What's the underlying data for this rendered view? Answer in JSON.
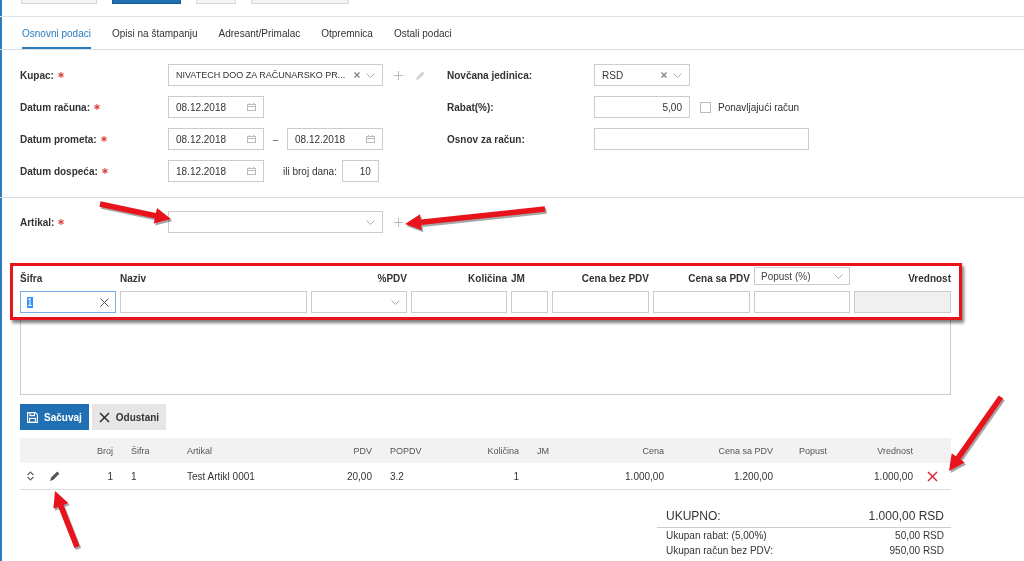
{
  "toolbar": {
    "buttons": [
      {
        "kind": "default"
      },
      {
        "kind": "primary"
      },
      {
        "kind": "default"
      },
      {
        "kind": "default"
      }
    ]
  },
  "tabs": [
    {
      "label": "Osnovni podaci",
      "selected": true
    },
    {
      "label": "Opisi na štampanju",
      "selected": false
    },
    {
      "label": "Adresant/Primalac",
      "selected": false
    },
    {
      "label": "Otpremnica",
      "selected": false
    },
    {
      "label": "Ostali podaci",
      "selected": false
    }
  ],
  "left_fields": [
    {
      "kind": "combo",
      "label": "Kupac:",
      "required": true,
      "value": "NIVATECH DOO ZA RAČUNARSKO PR...",
      "can_add": true,
      "can_edit": true
    },
    {
      "kind": "date",
      "label": "Datum računa:",
      "required": true,
      "value": "08.12.2018"
    },
    {
      "kind": "date_range",
      "label": "Datum prometa:",
      "required": true,
      "from": "08.12.2018",
      "separator": "–",
      "to": "08.12.2018"
    },
    {
      "kind": "date_days",
      "label": "Datum dospeća:",
      "required": true,
      "value": "18.12.2018",
      "days_label": "ili broj dana:",
      "days": "10"
    }
  ],
  "right_fields": [
    {
      "kind": "combo",
      "label": "Novčana jedinica:",
      "required": false,
      "value": "RSD"
    },
    {
      "kind": "number_check",
      "label": "Rabat(%):",
      "required": false,
      "value": "5,00",
      "checkbox": {
        "label": "Ponavljajući račun",
        "checked": false
      }
    },
    {
      "kind": "text",
      "label": "Osnov za račun:",
      "required": false
    }
  ],
  "article": {
    "kind": "combo",
    "label": "Artikal:",
    "required": true,
    "can_add": true,
    "can_edit": false
  },
  "entry_row": {
    "columns": [
      {
        "header": {
          "kind": "label",
          "text": "Šifra"
        },
        "kind": "code",
        "value": "1",
        "value_highlighted": true
      },
      {
        "header": {
          "kind": "label",
          "text": "Naziv"
        },
        "kind": "text"
      },
      {
        "header": {
          "kind": "label",
          "text": "%PDV"
        },
        "kind": "select"
      },
      {
        "header": {
          "kind": "label",
          "text": "Količina"
        },
        "kind": "text"
      },
      {
        "header": {
          "kind": "label",
          "text": "JM"
        },
        "kind": "text"
      },
      {
        "header": {
          "kind": "label",
          "text": "Cena bez PDV"
        },
        "kind": "text"
      },
      {
        "header": {
          "kind": "label",
          "text": "Cena sa PDV"
        },
        "kind": "text"
      },
      {
        "header": {
          "kind": "dropdown",
          "text": "Popust (%)"
        },
        "kind": "text"
      },
      {
        "header": {
          "kind": "label",
          "text": "Vrednost"
        },
        "kind": "readonly"
      }
    ]
  },
  "buttons": [
    {
      "kind": "primary",
      "label": "Sačuvaj"
    },
    {
      "kind": "secondary",
      "label": "Odustani"
    }
  ],
  "items_table": {
    "columns": [
      "Broj",
      "Šifra",
      "Artikal",
      "PDV",
      "POPDV",
      "Količina",
      "JM",
      "Cena",
      "Cena sa PDV",
      "Popust",
      "Vrednost"
    ],
    "rows": [
      {
        "cells": [
          "1",
          "1",
          "Test Artikl 0001",
          "20,00",
          "3.2",
          "1",
          null,
          "1.000,00",
          "1.200,00",
          null,
          "1.000,00"
        ]
      }
    ]
  },
  "totals": {
    "title": "UKUPNO:",
    "value": "1.000,00 RSD",
    "lines": [
      {
        "label": "Ukupan rabat: (5,00%)",
        "value": "50,00 RSD"
      },
      {
        "label": "Ukupan račun bez PDV:",
        "value": "950,00 RSD"
      }
    ]
  }
}
